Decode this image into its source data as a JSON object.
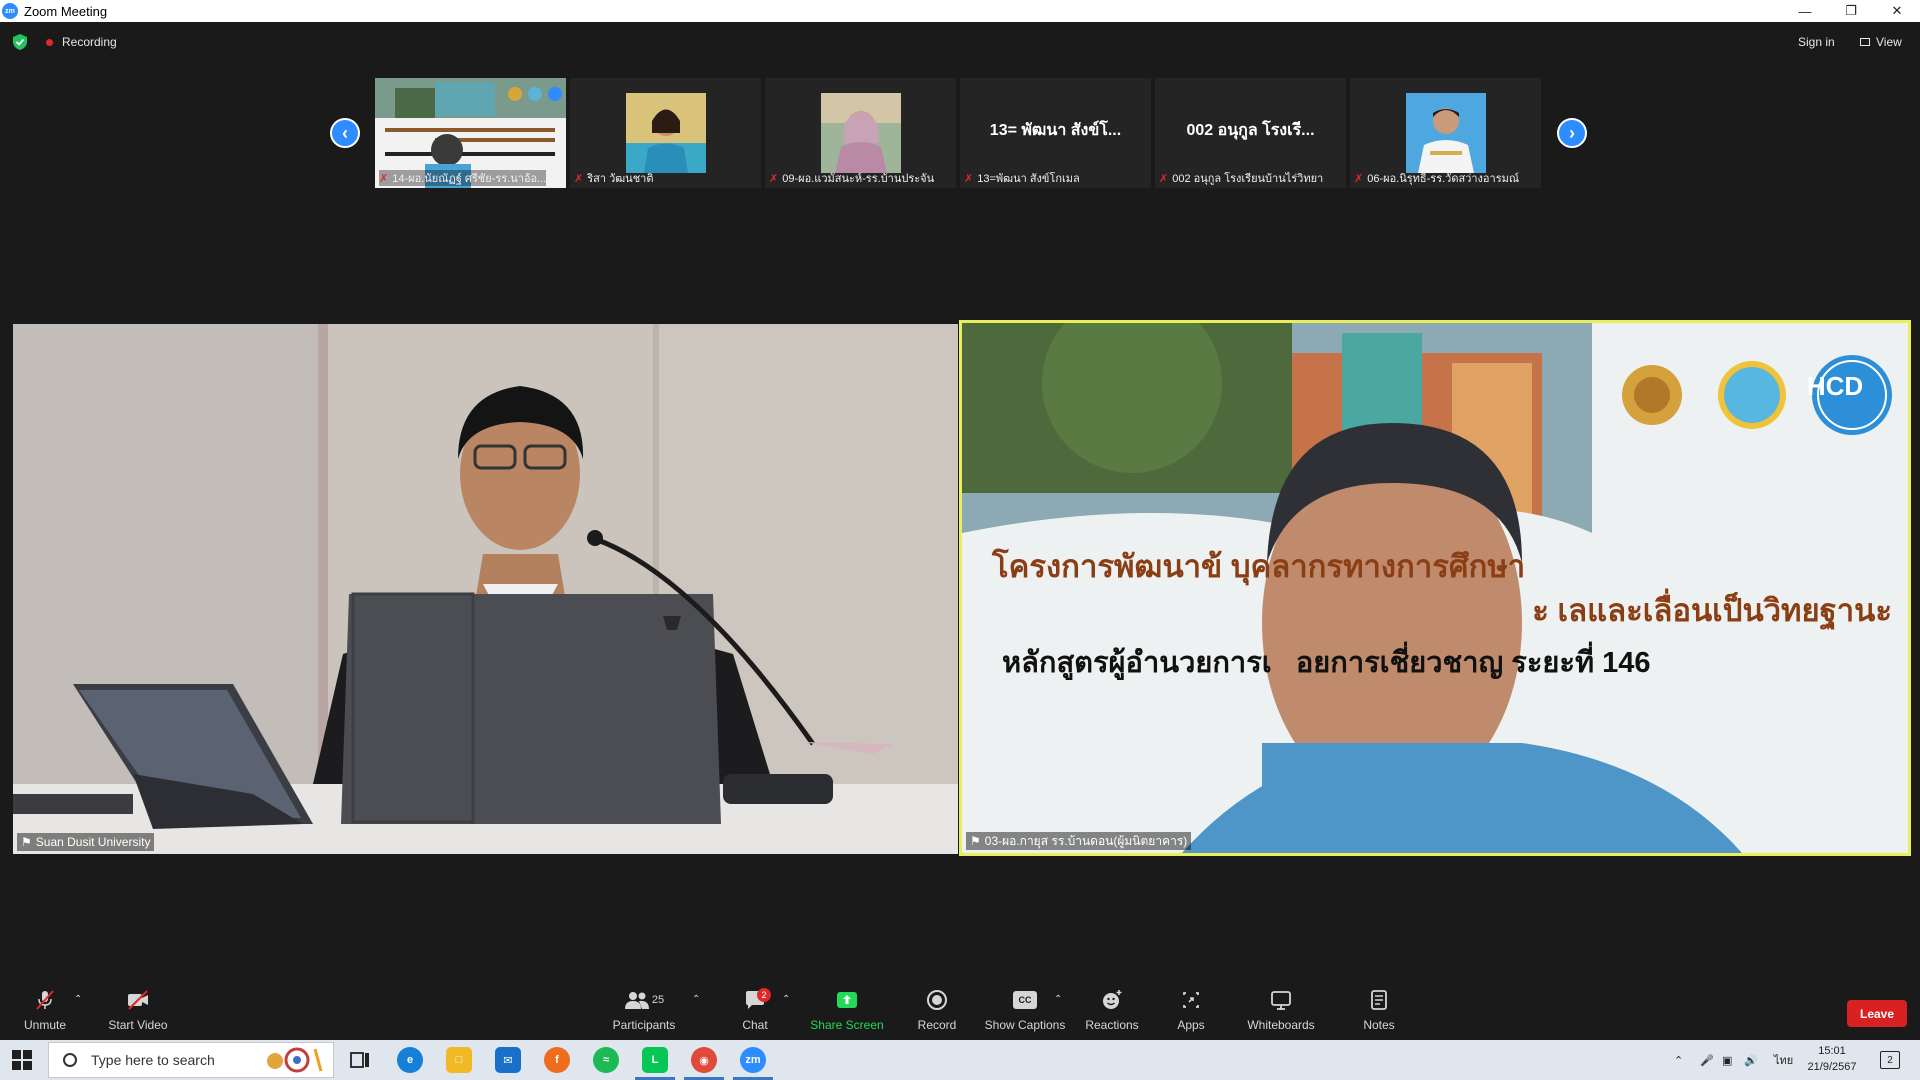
{
  "window": {
    "title": "Zoom Meeting",
    "app_logo": "zm"
  },
  "topbar": {
    "recording_label": "Recording",
    "signin_label": "Sign in",
    "view_label": "View"
  },
  "thumbnails": [
    {
      "name": "14-ผอ.นัยณัฏฐ์ ศรีชัย-รร.นาอ้อ...",
      "kind": "slide"
    },
    {
      "name": "ริสา วัฒนชาติ",
      "kind": "photo"
    },
    {
      "name": "09-ผอ.แวมัสนะห์-รร.บ้านประจัน",
      "kind": "photo"
    },
    {
      "name": "13=พัฒนา สังข์โกเมล",
      "kind": "text",
      "display": "13= พัฒนา สังข์โ..."
    },
    {
      "name": "002 อนุกูล โรงเรียนบ้านไร่วิทยา",
      "kind": "text",
      "display": "002 อนุกูล โรงเรี..."
    },
    {
      "name": "06-ผอ.นิรุทธิ์-รร.วัดสว่างอารมณ์",
      "kind": "photo"
    }
  ],
  "main_tiles": {
    "left_name": "Suan Dusit University",
    "right_name": "03-ผอ.กายุส รร.บ้านดอน(ผู้มนิตยาคาร)",
    "slide_line1": "โครงการพัฒนาข้ บุคลากรทางการศึกษา",
    "slide_line2": "ะ เลและเลื่อนเป็นวิทยฐานะ",
    "slide_line3": "หลักสูตรผู้อำนวยการเ   อยการเชี่ยวชาญ ระยะที่ 146",
    "logo_hcd": "HCD"
  },
  "toolbar": {
    "unmute": "Unmute",
    "start_video": "Start Video",
    "participants": "Participants",
    "participants_count": "25",
    "chat": "Chat",
    "chat_badge": "2",
    "share_screen": "Share Screen",
    "record": "Record",
    "show_captions": "Show Captions",
    "captions_icon_text": "CC",
    "reactions": "Reactions",
    "apps": "Apps",
    "whiteboards": "Whiteboards",
    "notes": "Notes",
    "leave": "Leave"
  },
  "taskbar": {
    "search_placeholder": "Type here to search",
    "lang": "ไทย",
    "time": "15:01",
    "date": "21/9/2567",
    "notification_count": "2"
  },
  "colors": {
    "accent": "#2d8cff",
    "share_green": "#23d959",
    "leave_red": "#d92121",
    "active_speaker": "#e9ef5a"
  }
}
